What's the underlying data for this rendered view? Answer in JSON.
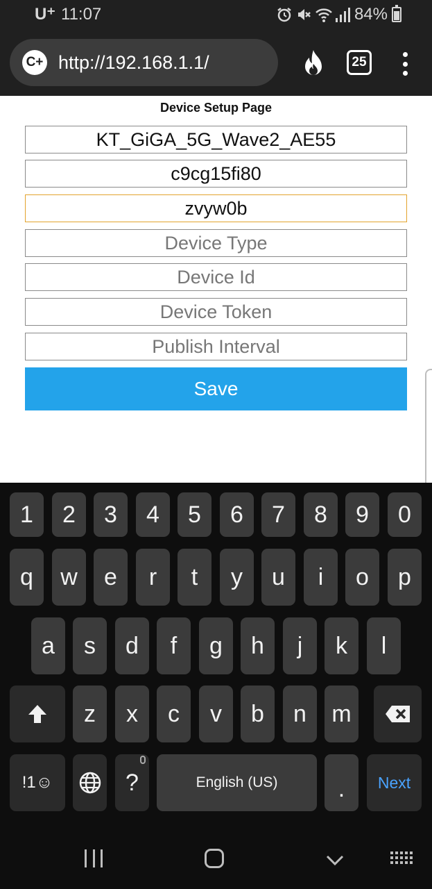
{
  "status_bar": {
    "carrier": "U⁺",
    "time": "11:07",
    "battery": "84%",
    "icons": [
      "alarm-icon",
      "mute-icon",
      "wifi-icon",
      "signal-icon",
      "battery-icon"
    ]
  },
  "browser": {
    "site_badge": "C+",
    "url": "http://192.168.1.1/",
    "tab_count": "25",
    "icons": [
      "flame-icon",
      "tabs-icon",
      "more-menu-icon"
    ]
  },
  "page": {
    "title": "Device Setup Page",
    "fields": [
      {
        "name": "ssid-field",
        "value": "KT_GiGA_5G_Wave2_AE55",
        "placeholder": ""
      },
      {
        "name": "password-field",
        "value": "c9cg15fi80",
        "placeholder": ""
      },
      {
        "name": "focused-field",
        "value": "zvyw0b",
        "placeholder": ""
      },
      {
        "name": "device-type-field",
        "value": "",
        "placeholder": "Device Type"
      },
      {
        "name": "device-id-field",
        "value": "",
        "placeholder": "Device Id"
      },
      {
        "name": "device-token-field",
        "value": "",
        "placeholder": "Device Token"
      },
      {
        "name": "publish-interval-field",
        "value": "",
        "placeholder": "Publish Interval"
      }
    ],
    "save_label": "Save"
  },
  "keyboard": {
    "row_numbers": [
      "1",
      "2",
      "3",
      "4",
      "5",
      "6",
      "7",
      "8",
      "9",
      "0"
    ],
    "row_top": [
      "q",
      "w",
      "e",
      "r",
      "t",
      "y",
      "u",
      "i",
      "o",
      "p"
    ],
    "row_middle": [
      "a",
      "s",
      "d",
      "f",
      "g",
      "h",
      "j",
      "k",
      "l"
    ],
    "row_bottom": [
      "z",
      "x",
      "c",
      "v",
      "b",
      "n",
      "m"
    ],
    "symbols_label": "!1☺",
    "question_label": "?",
    "space_label": "English (US)",
    "period_label": ".",
    "next_label": "Next"
  },
  "colors": {
    "accent": "#23a3ea",
    "focus": "#e3a32c",
    "next": "#4aa3ff"
  }
}
